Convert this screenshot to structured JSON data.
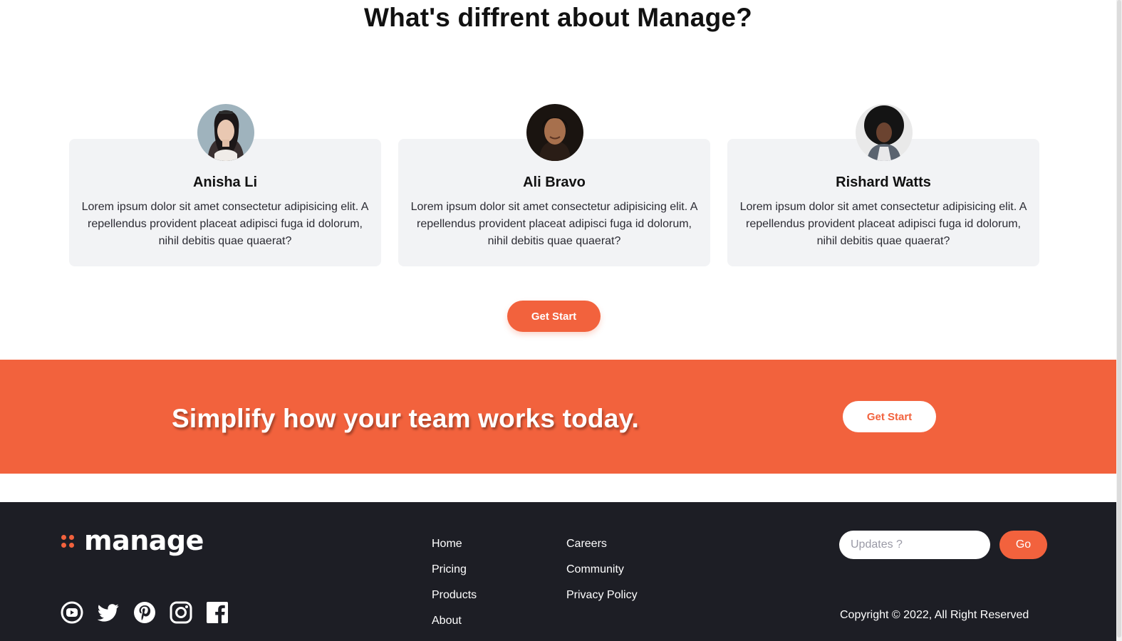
{
  "section": {
    "title": "What's diffrent about Manage?"
  },
  "testimonials": [
    {
      "name": "Anisha Li",
      "text": "Lorem ipsum dolor sit amet consectetur adipisicing elit. A repellendus provident placeat adipisci fuga id dolorum, nihil debitis quae quaerat?"
    },
    {
      "name": "Ali Bravo",
      "text": "Lorem ipsum dolor sit amet consectetur adipisicing elit. A repellendus provident placeat adipisci fuga id dolorum, nihil debitis quae quaerat?"
    },
    {
      "name": "Rishard Watts",
      "text": "Lorem ipsum dolor sit amet consectetur adipisicing elit. A repellendus provident placeat adipisci fuga id dolorum, nihil debitis quae quaerat?"
    }
  ],
  "primary_button": "Get Start",
  "cta": {
    "text": "Simplify how your team works today.",
    "button": "Get Start"
  },
  "footer": {
    "logo_text": "manage",
    "nav_col1": [
      "Home",
      "Pricing",
      "Products",
      "About"
    ],
    "nav_col2": [
      "Careers",
      "Community",
      "Privacy Policy"
    ],
    "newsletter_placeholder": "Updates ?",
    "go_button": "Go",
    "copyright": "Copyright © 2022, All Right Reserved",
    "social_icons": [
      "youtube-icon",
      "twitter-icon",
      "pinterest-icon",
      "instagram-icon",
      "facebook-icon"
    ]
  },
  "colors": {
    "accent": "#f2623d",
    "footer_bg": "#1d1e25",
    "card_bg": "#f2f3f5"
  }
}
